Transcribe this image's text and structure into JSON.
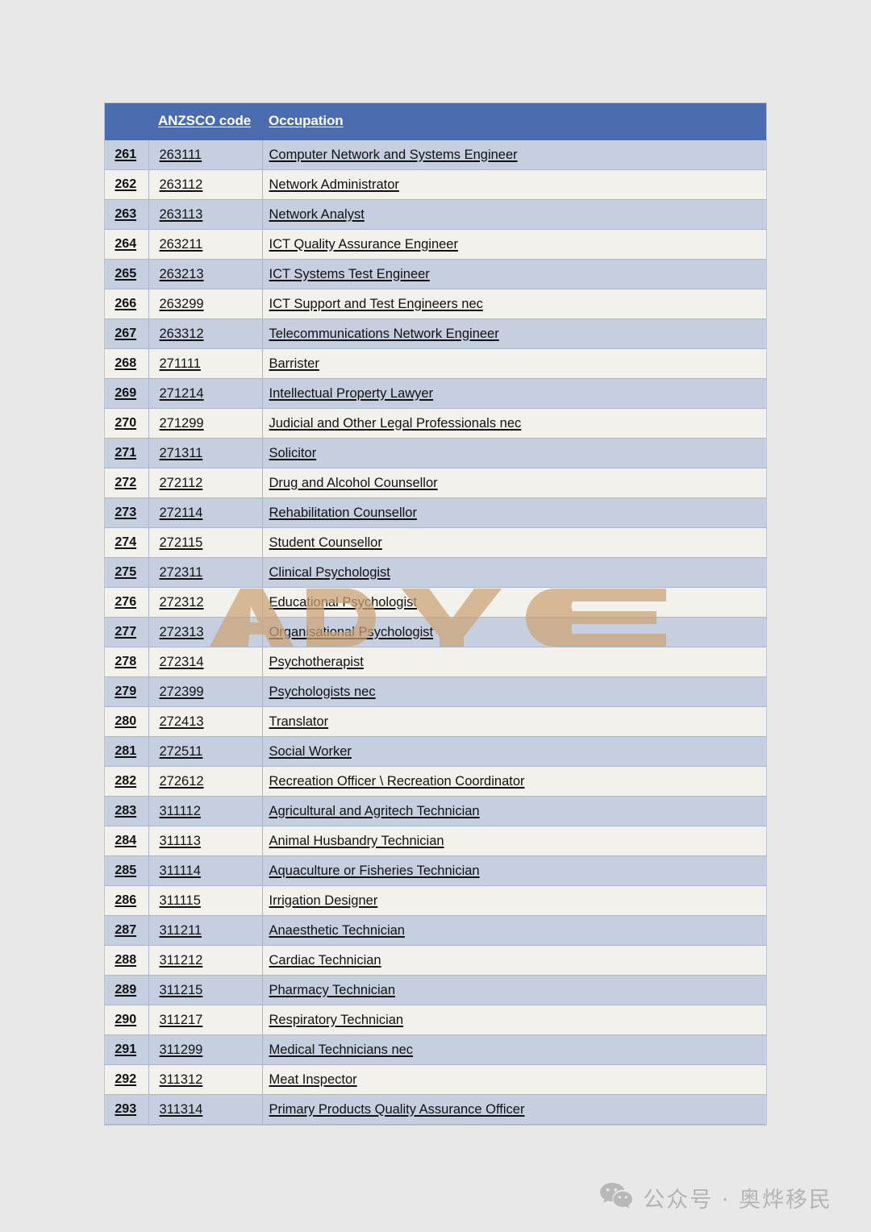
{
  "page": {
    "background_color": "#e8e8e8"
  },
  "table": {
    "header": {
      "index_label": "",
      "code_label": "ANZSCO code",
      "occupation_label": "Occupation",
      "background_color": "#4a6cae",
      "text_color": "#ffffff"
    },
    "row_colors": {
      "odd": "#c5cfe0",
      "even": "#f2f1ec"
    },
    "rows": [
      {
        "index": "261",
        "code": "263111",
        "occupation": "Computer Network and Systems Engineer"
      },
      {
        "index": "262",
        "code": "263112",
        "occupation": "Network Administrator"
      },
      {
        "index": "263",
        "code": "263113",
        "occupation": "Network Analyst"
      },
      {
        "index": "264",
        "code": "263211",
        "occupation": "ICT Quality Assurance Engineer"
      },
      {
        "index": "265",
        "code": "263213",
        "occupation": "ICT Systems Test Engineer"
      },
      {
        "index": "266",
        "code": "263299",
        "occupation": "ICT Support and Test Engineers nec"
      },
      {
        "index": "267",
        "code": "263312",
        "occupation": "Telecommunications Network Engineer"
      },
      {
        "index": "268",
        "code": "271111",
        "occupation": "Barrister"
      },
      {
        "index": "269",
        "code": "271214",
        "occupation": "Intellectual Property Lawyer"
      },
      {
        "index": "270",
        "code": "271299",
        "occupation": "Judicial and Other Legal Professionals nec"
      },
      {
        "index": "271",
        "code": "271311",
        "occupation": "Solicitor"
      },
      {
        "index": "272",
        "code": "272112",
        "occupation": "Drug and Alcohol Counsellor"
      },
      {
        "index": "273",
        "code": "272114",
        "occupation": "Rehabilitation Counsellor"
      },
      {
        "index": "274",
        "code": "272115",
        "occupation": "Student Counsellor"
      },
      {
        "index": "275",
        "code": "272311",
        "occupation": "Clinical Psychologist"
      },
      {
        "index": "276",
        "code": "272312",
        "occupation": "Educational Psychologist"
      },
      {
        "index": "277",
        "code": "272313",
        "occupation": "Organisational Psychologist"
      },
      {
        "index": "278",
        "code": "272314",
        "occupation": "Psychotherapist"
      },
      {
        "index": "279",
        "code": "272399",
        "occupation": "Psychologists nec"
      },
      {
        "index": "280",
        "code": "272413",
        "occupation": "Translator"
      },
      {
        "index": "281",
        "code": "272511",
        "occupation": "Social Worker"
      },
      {
        "index": "282",
        "code": "272612",
        "occupation": "Recreation Officer \\ Recreation Coordinator"
      },
      {
        "index": "283",
        "code": "311112",
        "occupation": "Agricultural and Agritech Technician"
      },
      {
        "index": "284",
        "code": "311113",
        "occupation": "Animal Husbandry Technician"
      },
      {
        "index": "285",
        "code": "311114",
        "occupation": "Aquaculture or Fisheries Technician"
      },
      {
        "index": "286",
        "code": "311115",
        "occupation": "Irrigation Designer"
      },
      {
        "index": "287",
        "code": "311211",
        "occupation": "Anaesthetic Technician"
      },
      {
        "index": "288",
        "code": "311212",
        "occupation": "Cardiac Technician"
      },
      {
        "index": "289",
        "code": "311215",
        "occupation": "Pharmacy Technician"
      },
      {
        "index": "290",
        "code": "311217",
        "occupation": "Respiratory Technician"
      },
      {
        "index": "291",
        "code": "311299",
        "occupation": "Medical Technicians nec"
      },
      {
        "index": "292",
        "code": "311312",
        "occupation": "Meat Inspector"
      },
      {
        "index": "293",
        "code": "311314",
        "occupation": "Primary Products Quality Assurance Officer"
      }
    ]
  },
  "watermark": {
    "text": "AOYE",
    "color": "#cda375"
  },
  "footer": {
    "text": "公众号 · 奥烨移民",
    "icon": "wechat-icon",
    "color": "#b4b4b4"
  }
}
